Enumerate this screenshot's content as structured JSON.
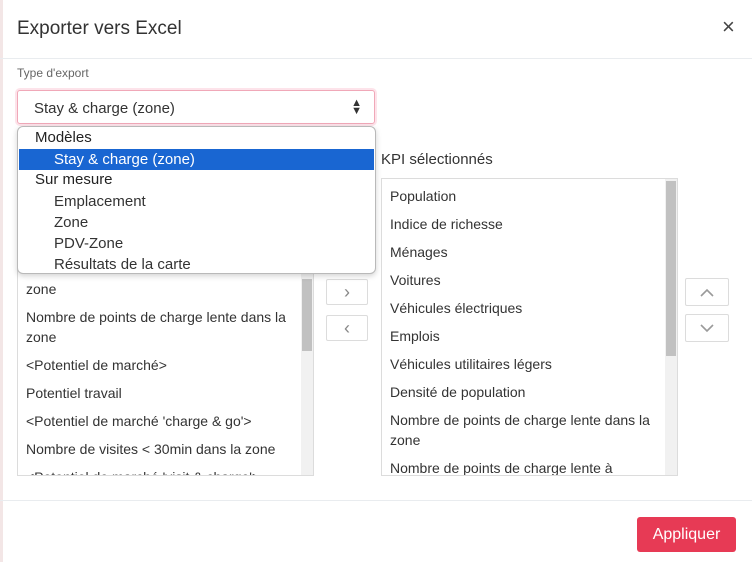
{
  "modal": {
    "title": "Exporter vers Excel",
    "close_label": "×"
  },
  "export_type": {
    "label": "Type d'export",
    "selected": "Stay & charge (zone)",
    "dropdown": {
      "groups": [
        {
          "label": "Modèles",
          "options": [
            {
              "label": "Stay & charge (zone)",
              "selected": true
            }
          ]
        },
        {
          "label": "Sur mesure",
          "options": [
            {
              "label": "Emplacement"
            },
            {
              "label": "Zone"
            },
            {
              "label": "PDV-Zone"
            },
            {
              "label": "Résultats de la carte"
            }
          ]
        }
      ]
    }
  },
  "available_kpi": {
    "items": [
      "zone",
      "Nombre de points de charge lente dans la zone",
      "<Potentiel de marché>",
      "Potentiel travail",
      "<Potentiel de marché 'charge & go'>",
      "Nombre de visites < 30min dans la zone",
      "<Potentiel de marché 'visit & charge'>"
    ]
  },
  "selected_kpi": {
    "title": "KPI sélectionnés",
    "items": [
      "Population",
      "Indice de richesse",
      "Ménages",
      "Voitures",
      "Véhicules électriques",
      "Emplois",
      "Véhicules utilitaires légers",
      "Densité de population",
      "Nombre de points de charge lente dans la zone",
      "Nombre de points de charge lente à"
    ]
  },
  "buttons": {
    "add_label": "›",
    "remove_label": "‹",
    "apply_label": "Appliquer"
  },
  "colors": {
    "accent": "#e73a55",
    "selection": "#1966d2"
  }
}
